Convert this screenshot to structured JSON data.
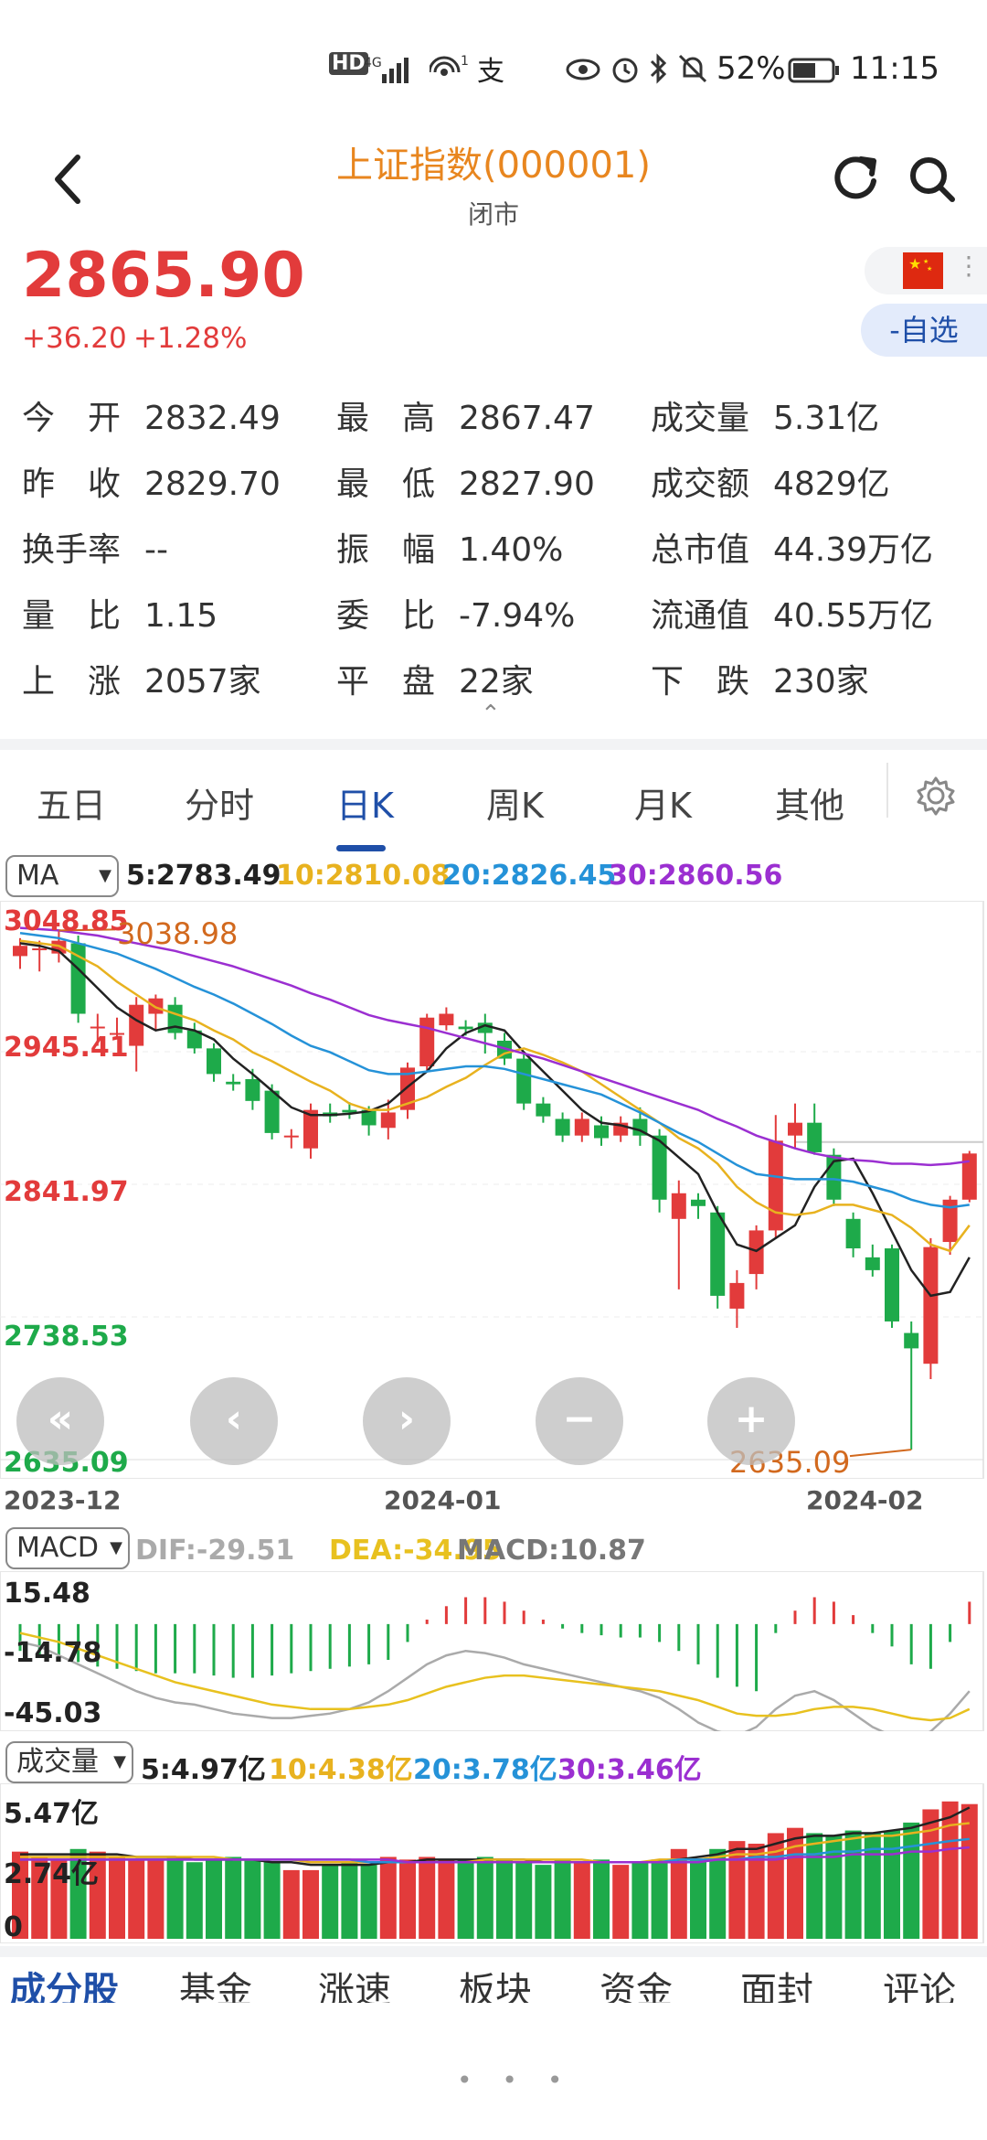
{
  "status_bar": {
    "network": "HD 4G",
    "icons": [
      "hd-icon",
      "signal-icon",
      "hotspot-icon",
      "pay-icon",
      "eye-icon",
      "alarm-icon",
      "bluetooth-icon",
      "mute-icon",
      "battery-icon"
    ],
    "battery": "52%",
    "time": "11:15"
  },
  "header": {
    "title": "上证指数(000001)",
    "status": "闭市",
    "icons": [
      "back-icon",
      "refresh-icon",
      "search-icon"
    ]
  },
  "quote": {
    "price": "2865.90",
    "change": "+36.20",
    "change_pct": "+1.28%",
    "watch_button": "-自选"
  },
  "stats": [
    {
      "label": "今　开",
      "value": "2832.49"
    },
    {
      "label": "最　高",
      "value": "2867.47"
    },
    {
      "label": "成交量",
      "value": "5.31亿"
    },
    {
      "label": "昨　收",
      "value": "2829.70"
    },
    {
      "label": "最　低",
      "value": "2827.90"
    },
    {
      "label": "成交额",
      "value": "4829亿"
    },
    {
      "label": "换手率",
      "value": "--"
    },
    {
      "label": "振　幅",
      "value": "1.40%"
    },
    {
      "label": "总市值",
      "value": "44.39万亿"
    },
    {
      "label": "量　比",
      "value": "1.15"
    },
    {
      "label": "委　比",
      "value": "-7.94%"
    },
    {
      "label": "流通值",
      "value": "40.55万亿"
    },
    {
      "label": "上　涨",
      "value": "2057家"
    },
    {
      "label": "平　盘",
      "value": "22家"
    },
    {
      "label": "下　跌",
      "value": "230家"
    }
  ],
  "tabs": [
    {
      "label": "五日"
    },
    {
      "label": "分时"
    },
    {
      "label": "日K"
    },
    {
      "label": "周K"
    },
    {
      "label": "月K"
    },
    {
      "label": "其他"
    }
  ],
  "active_tab": "日K",
  "ma_legend": {
    "selector": "MA",
    "ma5": "5:2783.49",
    "ma10": "10:2810.08",
    "ma20": "20:2826.45",
    "ma30": "30:2860.56"
  },
  "colors": {
    "up": "#e23b3b",
    "down": "#1eaa4a",
    "ma5": "#222222",
    "ma10": "#e8b21f",
    "ma20": "#2592d8",
    "ma30": "#9b2fd1",
    "accent": "#1f4fa8",
    "title": "#e8861f"
  },
  "kline": {
    "y_labels": [
      "3048.85",
      "2945.41",
      "2841.97",
      "2738.53",
      "2635.09"
    ],
    "max_label": "3038.98",
    "min_label": "2635.09",
    "dates": [
      "2023-12",
      "2024-01",
      "2024-02"
    ],
    "controls": [
      "«",
      "‹",
      "›",
      "−",
      "+"
    ]
  },
  "macd": {
    "selector": "MACD",
    "dif": "DIF:-29.51",
    "dea": "DEA:-34.95",
    "macd": "MACD:10.87",
    "y_labels": [
      "15.48",
      "-14.78",
      "-45.03"
    ]
  },
  "volume": {
    "selector": "成交量",
    "ma5": "5:4.97亿",
    "ma10": "10:4.38亿",
    "ma20": "20:3.78亿",
    "ma30": "30:3.46亿",
    "y_labels": [
      "5.47亿",
      "2.74亿",
      "0"
    ]
  },
  "bottom_tabs": [
    "成分股",
    "基金",
    "涨速",
    "板块",
    "资金",
    "面封",
    "评论"
  ],
  "chart_data": {
    "type": "candlestick",
    "candles": [
      {
        "o": 3020,
        "c": 3028,
        "h": 3034,
        "l": 3010
      },
      {
        "o": 3025,
        "c": 3026,
        "h": 3032,
        "l": 3008
      },
      {
        "o": 3022,
        "c": 3032,
        "h": 3040,
        "l": 3015
      },
      {
        "o": 3030,
        "c": 2975,
        "h": 3036,
        "l": 2968
      },
      {
        "o": 2965,
        "c": 2965,
        "h": 2975,
        "l": 2950
      },
      {
        "o": 2960,
        "c": 2960,
        "h": 2972,
        "l": 2955
      },
      {
        "o": 2950,
        "c": 2982,
        "h": 2988,
        "l": 2930
      },
      {
        "o": 2975,
        "c": 2987,
        "h": 2990,
        "l": 2962
      },
      {
        "o": 2982,
        "c": 2960,
        "h": 2988,
        "l": 2955
      },
      {
        "o": 2962,
        "c": 2948,
        "h": 2968,
        "l": 2944
      },
      {
        "o": 2948,
        "c": 2928,
        "h": 2952,
        "l": 2922
      },
      {
        "o": 2922,
        "c": 2920,
        "h": 2928,
        "l": 2915
      },
      {
        "o": 2924,
        "c": 2907,
        "h": 2932,
        "l": 2900
      },
      {
        "o": 2915,
        "c": 2882,
        "h": 2920,
        "l": 2877
      },
      {
        "o": 2880,
        "c": 2880,
        "h": 2885,
        "l": 2870
      },
      {
        "o": 2870,
        "c": 2900,
        "h": 2905,
        "l": 2862
      },
      {
        "o": 2898,
        "c": 2895,
        "h": 2905,
        "l": 2890
      },
      {
        "o": 2900,
        "c": 2898,
        "h": 2906,
        "l": 2893
      },
      {
        "o": 2900,
        "c": 2888,
        "h": 2903,
        "l": 2880
      },
      {
        "o": 2886,
        "c": 2898,
        "h": 2908,
        "l": 2877
      },
      {
        "o": 2900,
        "c": 2933,
        "h": 2937,
        "l": 2893
      },
      {
        "o": 2934,
        "c": 2972,
        "h": 2975,
        "l": 2930
      },
      {
        "o": 2966,
        "c": 2975,
        "h": 2980,
        "l": 2962
      },
      {
        "o": 2965,
        "c": 2963,
        "h": 2970,
        "l": 2958
      },
      {
        "o": 2968,
        "c": 2960,
        "h": 2975,
        "l": 2944
      },
      {
        "o": 2954,
        "c": 2940,
        "h": 2960,
        "l": 2935
      },
      {
        "o": 2940,
        "c": 2905,
        "h": 2945,
        "l": 2900
      },
      {
        "o": 2905,
        "c": 2895,
        "h": 2910,
        "l": 2890
      },
      {
        "o": 2893,
        "c": 2880,
        "h": 2898,
        "l": 2875
      },
      {
        "o": 2880,
        "c": 2893,
        "h": 2898,
        "l": 2875
      },
      {
        "o": 2888,
        "c": 2878,
        "h": 2895,
        "l": 2872
      },
      {
        "o": 2880,
        "c": 2890,
        "h": 2895,
        "l": 2875
      },
      {
        "o": 2893,
        "c": 2880,
        "h": 2902,
        "l": 2872
      },
      {
        "o": 2880,
        "c": 2830,
        "h": 2885,
        "l": 2820
      },
      {
        "o": 2815,
        "c": 2835,
        "h": 2845,
        "l": 2760
      },
      {
        "o": 2830,
        "c": 2825,
        "h": 2835,
        "l": 2815
      },
      {
        "o": 2820,
        "c": 2755,
        "h": 2825,
        "l": 2745
      },
      {
        "o": 2745,
        "c": 2765,
        "h": 2775,
        "l": 2730
      },
      {
        "o": 2772,
        "c": 2806,
        "h": 2810,
        "l": 2760
      },
      {
        "o": 2806,
        "c": 2876,
        "h": 2896,
        "l": 2800
      },
      {
        "o": 2880,
        "c": 2890,
        "h": 2905,
        "l": 2870
      },
      {
        "o": 2890,
        "c": 2867,
        "h": 2905,
        "l": 2865
      },
      {
        "o": 2865,
        "c": 2830,
        "h": 2870,
        "l": 2825
      },
      {
        "o": 2815,
        "c": 2792,
        "h": 2820,
        "l": 2785
      },
      {
        "o": 2785,
        "c": 2775,
        "h": 2795,
        "l": 2770
      },
      {
        "o": 2792,
        "c": 2735,
        "h": 2795,
        "l": 2730
      },
      {
        "o": 2726,
        "c": 2714,
        "h": 2735,
        "l": 2635
      },
      {
        "o": 2702,
        "c": 2793,
        "h": 2800,
        "l": 2690
      },
      {
        "o": 2797,
        "c": 2830,
        "h": 2833,
        "l": 2787
      },
      {
        "o": 2830,
        "c": 2866,
        "h": 2868,
        "l": 2828
      }
    ],
    "ylim": [
      2635.09,
      3048.85
    ],
    "ma_series": [
      {
        "name": "MA5",
        "values": [
          3030,
          3028,
          3024,
          3010,
          2995,
          2980,
          2970,
          2962,
          2965,
          2962,
          2955,
          2940,
          2928,
          2915,
          2902,
          2896,
          2896,
          2897,
          2899,
          2905,
          2918,
          2930,
          2948,
          2960,
          2966,
          2962,
          2945,
          2930,
          2915,
          2900,
          2890,
          2888,
          2884,
          2876,
          2863,
          2850,
          2820,
          2795,
          2790,
          2800,
          2810,
          2840,
          2860,
          2862,
          2835,
          2805,
          2775,
          2755,
          2758,
          2785
        ]
      },
      {
        "name": "MA10",
        "values": [
          3032,
          3030,
          3028,
          3020,
          3012,
          3000,
          2990,
          2980,
          2975,
          2970,
          2962,
          2955,
          2945,
          2938,
          2930,
          2922,
          2915,
          2905,
          2900,
          2900,
          2905,
          2910,
          2918,
          2925,
          2935,
          2944,
          2948,
          2943,
          2937,
          2930,
          2920,
          2910,
          2900,
          2890,
          2878,
          2870,
          2858,
          2840,
          2828,
          2820,
          2818,
          2820,
          2826,
          2826,
          2822,
          2818,
          2808,
          2795,
          2790,
          2810
        ]
      },
      {
        "name": "MA20",
        "values": [
          3038,
          3036,
          3034,
          3030,
          3026,
          3022,
          3016,
          3010,
          3003,
          2996,
          2990,
          2983,
          2975,
          2967,
          2958,
          2950,
          2945,
          2938,
          2931,
          2928,
          2928,
          2930,
          2932,
          2934,
          2934,
          2932,
          2928,
          2924,
          2920,
          2916,
          2912,
          2905,
          2898,
          2890,
          2882,
          2875,
          2866,
          2857,
          2850,
          2848,
          2846,
          2846,
          2846,
          2844,
          2840,
          2836,
          2830,
          2826,
          2824,
          2826
        ]
      },
      {
        "name": "MA30",
        "values": [
          3042,
          3041,
          3040,
          3038,
          3036,
          3033,
          3030,
          3027,
          3024,
          3020,
          3016,
          3012,
          3007,
          3002,
          2997,
          2991,
          2986,
          2980,
          2974,
          2970,
          2967,
          2964,
          2960,
          2956,
          2952,
          2948,
          2944,
          2940,
          2935,
          2930,
          2925,
          2920,
          2915,
          2910,
          2905,
          2900,
          2893,
          2887,
          2880,
          2875,
          2870,
          2866,
          2863,
          2861,
          2860,
          2858,
          2858,
          2857,
          2858,
          2860
        ]
      }
    ],
    "macd_hist": [
      -12,
      -14,
      -15,
      -17,
      -19,
      -20,
      -21,
      -22,
      -22,
      -22,
      -23,
      -24,
      -24,
      -23,
      -22,
      -21,
      -20,
      -19,
      -18,
      -16,
      -8,
      2,
      8,
      12,
      12,
      10,
      6,
      2,
      -2,
      -4,
      -5,
      -6,
      -6,
      -8,
      -12,
      -18,
      -24,
      -28,
      -30,
      -4,
      6,
      12,
      10,
      4,
      -4,
      -10,
      -18,
      -20,
      -8,
      10
    ],
    "volumes": [
      3.3,
      3.1,
      3.0,
      3.4,
      3.3,
      3.1,
      3.0,
      3.0,
      3.1,
      2.9,
      3.0,
      3.1,
      3.0,
      2.9,
      2.6,
      2.6,
      2.8,
      2.9,
      2.8,
      3.1,
      3.0,
      3.1,
      3.0,
      3.0,
      3.1,
      3.0,
      2.9,
      2.8,
      3.0,
      2.9,
      3.0,
      2.8,
      2.9,
      3.0,
      3.4,
      3.0,
      3.4,
      3.7,
      3.6,
      4.0,
      4.2,
      4.0,
      3.9,
      4.1,
      4.0,
      4.1,
      4.4,
      4.9,
      5.2,
      5.1
    ]
  }
}
